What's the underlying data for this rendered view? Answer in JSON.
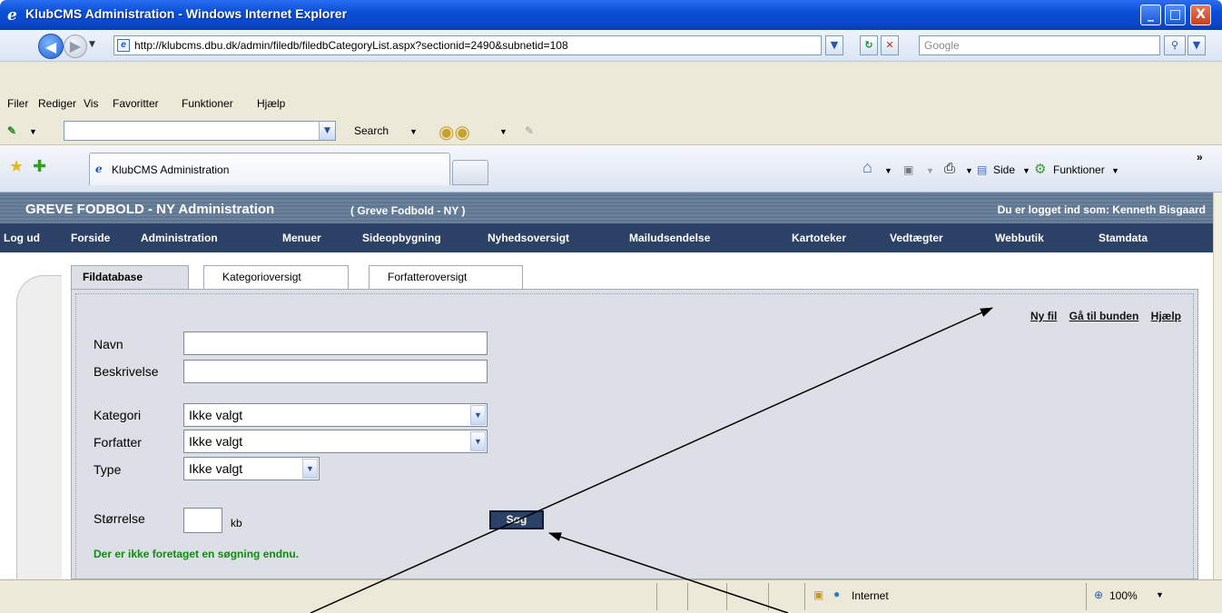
{
  "window": {
    "title": "KlubCMS Administration - Windows Internet Explorer",
    "buttons": [
      "_",
      "□",
      "X"
    ]
  },
  "address": {
    "url": "http://klubcms.dbu.dk/admin/filedb/filedbCategoryList.aspx?sectionid=2490&subnetid=108",
    "search_placeholder": "Google"
  },
  "menubar": {
    "items": [
      "Filer",
      "Rediger",
      "Vis",
      "Favoritter",
      "Funktioner",
      "Hjælp"
    ]
  },
  "google_toolbar": {
    "search_label": "Search"
  },
  "browser_tabs": {
    "active_label": "KlubCMS Administration",
    "tools": [
      "Side",
      "Funktioner"
    ]
  },
  "site": {
    "title": "GREVE FODBOLD - NY Administration",
    "subtitle": "( Greve Fodbold - NY )",
    "logged_in": "Du er logget ind som: Kenneth Bisgaard",
    "nav": [
      "Log ud",
      "Forside",
      "Administration",
      "Menuer",
      "Sideopbygning",
      "Nyhedsoversigt",
      "Mailudsendelse",
      "Kartoteker",
      "Vedtægter",
      "Webbutik",
      "Stamdata"
    ]
  },
  "content_tabs": [
    "Fildatabase",
    "Kategorioversigt",
    "Forfatteroversigt"
  ],
  "links": [
    "Ny fil",
    "Gå til bunden",
    "Hjælp"
  ],
  "form": {
    "name_label": "Navn",
    "name_value": "",
    "desc_label": "Beskrivelse",
    "desc_value": "",
    "category_label": "Kategori",
    "category_value": "Ikke valgt",
    "author_label": "Forfatter",
    "author_value": "Ikke valgt",
    "type_label": "Type",
    "type_value": "Ikke valgt",
    "size_label": "Størrelse",
    "size_value": "",
    "size_unit": "kb",
    "search_button": "Søg",
    "status": "Der er ikke foretaget en søgning endnu."
  },
  "statusbar": {
    "zone": "Internet",
    "zoom": "100%"
  }
}
